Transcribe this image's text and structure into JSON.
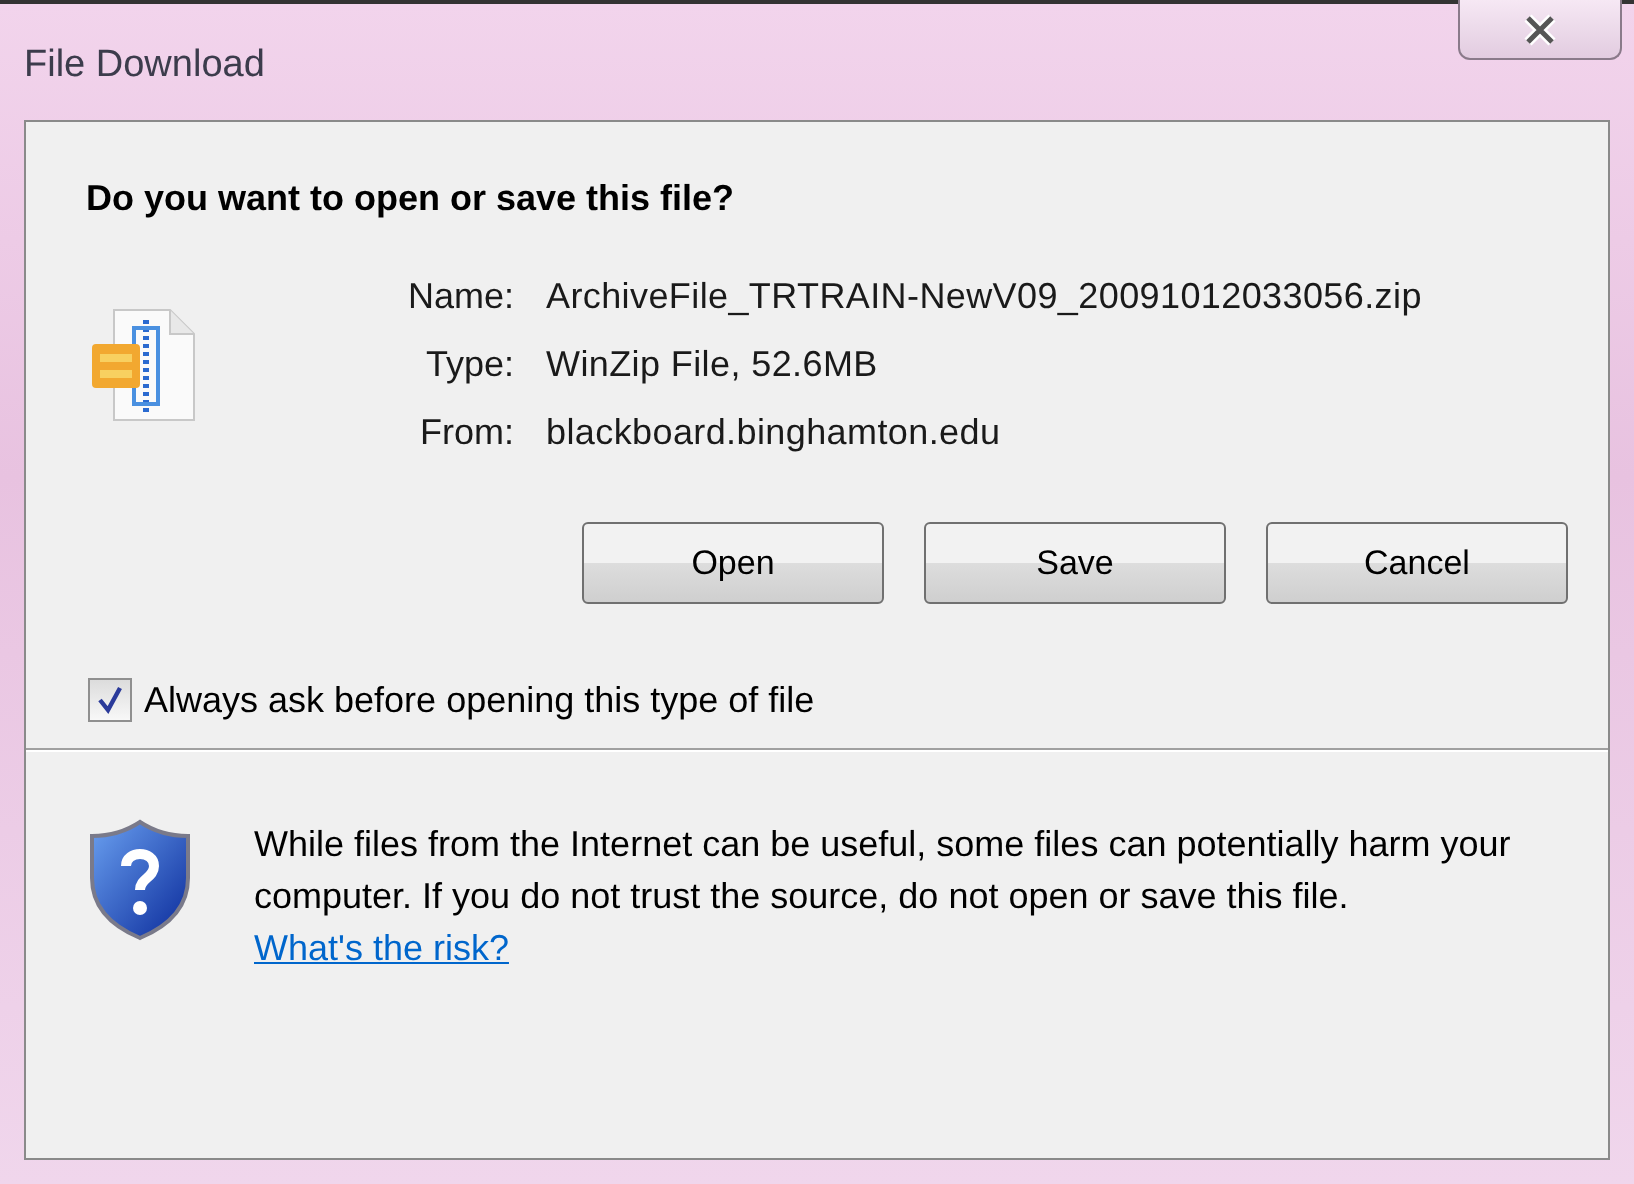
{
  "window": {
    "title": "File Download"
  },
  "heading": "Do you want to open or save this file?",
  "details": [
    {
      "label": "Name:",
      "value": "ArchiveFile_TRTRAIN-NewV09_20091012033056.zip"
    },
    {
      "label": "Type:",
      "value": "WinZip File, 52.6MB"
    },
    {
      "label": "From:",
      "value": "blackboard.binghamton.edu"
    }
  ],
  "buttons": [
    "Open",
    "Save",
    "Cancel"
  ],
  "always_ask": {
    "label": "Always ask before opening this type of file",
    "checked": true
  },
  "warning": {
    "text": "While files from the Internet can be useful, some files can potentially harm your computer. If you do not trust the source, do not open or save this file.",
    "link": "What's the risk?"
  }
}
